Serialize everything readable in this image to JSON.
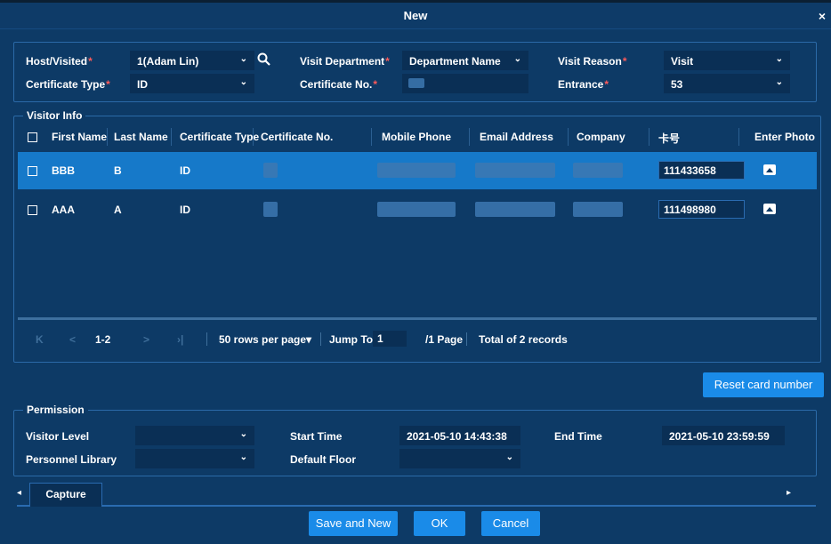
{
  "dialog": {
    "title": "New",
    "close_glyph": "×"
  },
  "top": {
    "host_label": "Host/Visited",
    "host_value": "1(Adam Lin)",
    "dept_label": "Visit Department",
    "dept_value": "Department Name",
    "reason_label": "Visit Reason",
    "reason_value": "Visit",
    "certtype_label": "Certificate Type",
    "certtype_value": "ID",
    "certno_label": "Certificate No.",
    "entrance_label": "Entrance",
    "entrance_value": "53",
    "required_mark": "*",
    "caret": "⌄"
  },
  "visitor": {
    "legend": "Visitor Info",
    "columns": [
      "First Name",
      "Last Name",
      "Certificate Type",
      "Certificate No.",
      "Mobile Phone",
      "Email Address",
      "Company",
      "卡号",
      "Enter Photo"
    ],
    "rows": [
      {
        "first": "BBB",
        "last": "B",
        "cert_type": "ID",
        "card": "111433658"
      },
      {
        "first": "AAA",
        "last": "A",
        "cert_type": "ID",
        "card": "111498980"
      }
    ]
  },
  "pager": {
    "first": "K",
    "prev": "<",
    "range": "1-2",
    "next": ">",
    "last": "›|",
    "rows_per_page": "50 rows per page",
    "rows_caret": "▾",
    "jump_label": "Jump To",
    "jump_value": "1",
    "page_text": "/1 Page",
    "total_text": "Total of 2 records"
  },
  "reset_button": "Reset card number",
  "permission": {
    "legend": "Permission",
    "visitor_level_label": "Visitor Level",
    "start_label": "Start Time",
    "start_value": "2021-05-10 14:43:38",
    "end_label": "End Time",
    "end_value": "2021-05-10 23:59:59",
    "library_label": "Personnel Library",
    "floor_label": "Default Floor"
  },
  "tabs": {
    "left_arrow": "◂",
    "right_arrow": "▸",
    "capture": "Capture"
  },
  "buttons": {
    "save_new": "Save and New",
    "ok": "OK",
    "cancel": "Cancel"
  },
  "colors": {
    "bg": "#0d3a66",
    "accent": "#1a8be8",
    "selected_row": "#1679c9",
    "required": "#ff5a5a"
  }
}
